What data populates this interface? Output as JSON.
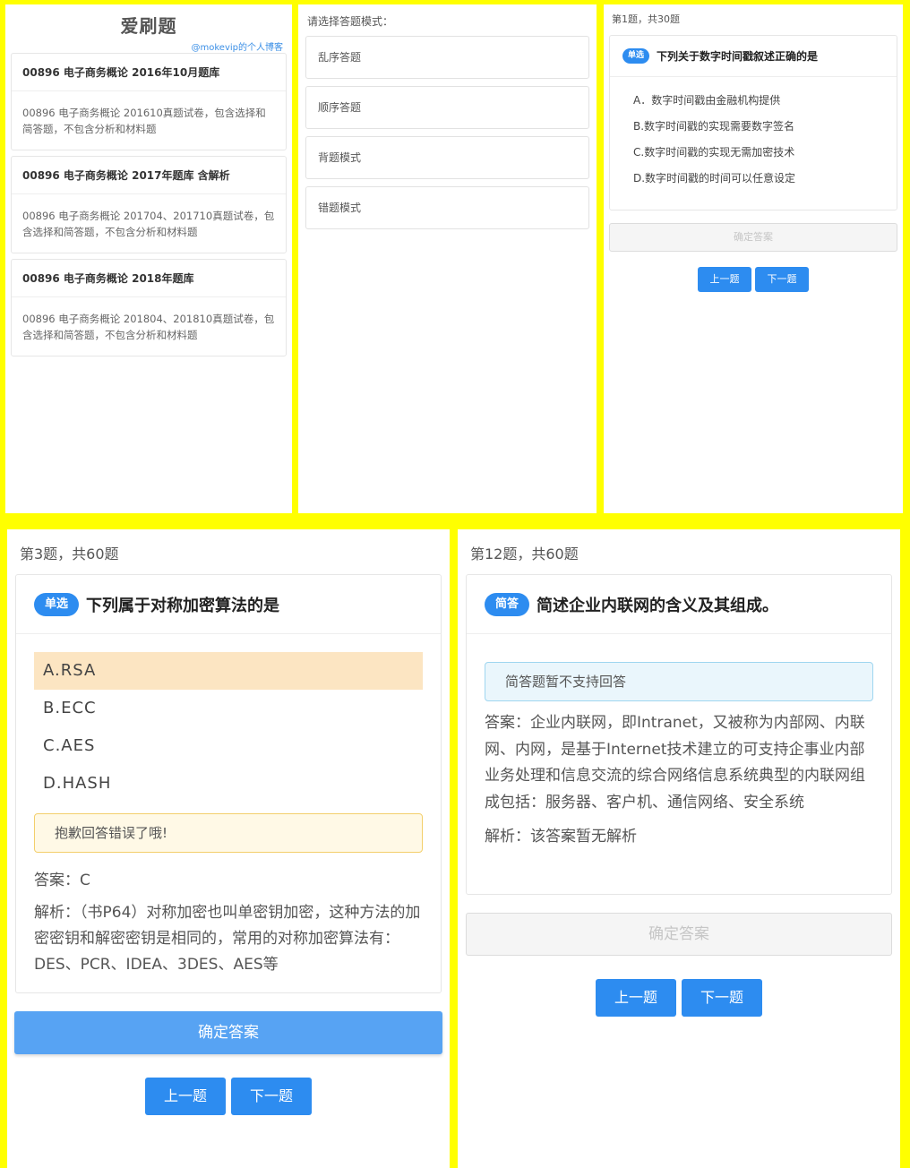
{
  "panel1": {
    "title": "爱刷题",
    "blog_link": "@mokevip的个人博客",
    "banks": [
      {
        "title": "00896 电子商务概论 2016年10月题库",
        "desc": "00896 电子商务概论 201610真题试卷，包含选择和简答题，不包含分析和材料题"
      },
      {
        "title": "00896 电子商务概论 2017年题库 含解析",
        "desc": "00896 电子商务概论 201704、201710真题试卷，包含选择和简答题，不包含分析和材料题"
      },
      {
        "title": "00896 电子商务概论 2018年题库",
        "desc": "00896 电子商务概论 201804、201810真题试卷，包含选择和简答题，不包含分析和材料题"
      }
    ]
  },
  "panel2": {
    "prompt": "请选择答题模式：",
    "modes": [
      "乱序答题",
      "顺序答题",
      "背题模式",
      "错题模式"
    ]
  },
  "panel3": {
    "counter": "第1题，共30题",
    "badge": "单选",
    "question": "下列关于数字时间戳叙述正确的是",
    "options": [
      "A．数字时间戳由金融机构提供",
      "B.数字时间戳的实现需要数字签名",
      "C.数字时间戳的实现无需加密技术",
      "D.数字时间戳的时间可以任意设定"
    ],
    "confirm": "确定答案",
    "prev": "上一题",
    "next": "下一题"
  },
  "panel4": {
    "counter": "第3题，共60题",
    "badge": "单选",
    "question": "下列属于对称加密算法的是",
    "options": [
      "A.RSA",
      "B.ECC",
      "C.AES",
      "D.HASH"
    ],
    "selected_option": "A.RSA",
    "alert": "抱歉回答错误了哦!",
    "answer": "答案：C",
    "explanation": "解析：（书P64）对称加密也叫单密钥加密，这种方法的加密密钥和解密密钥是相同的，常用的对称加密算法有：DES、PCR、IDEA、3DES、AES等",
    "confirm": "确定答案",
    "prev": "上一题",
    "next": "下一题"
  },
  "panel5": {
    "counter": "第12题，共60题",
    "badge": "简答",
    "question": "简述企业内联网的含义及其组成。",
    "alert": "简答题暂不支持回答",
    "answer": "答案：企业内联网，即Intranet，又被称为内部网、内联网、内网，是基于Internet技术建立的可支持企事业内部业务处理和信息交流的综合网络信息系统典型的内联网组成包括：服务器、客户机、通信网络、安全系统",
    "explanation": "解析：该答案暂无解析",
    "confirm": "确定答案",
    "prev": "上一题",
    "next": "下一题"
  },
  "colors": {
    "frame": "#ffff00",
    "primary": "#2d8cf0",
    "selected_option_bg": "#fce5c2",
    "warning_border": "#f3cf6b",
    "info_border": "#9fd6f0"
  }
}
